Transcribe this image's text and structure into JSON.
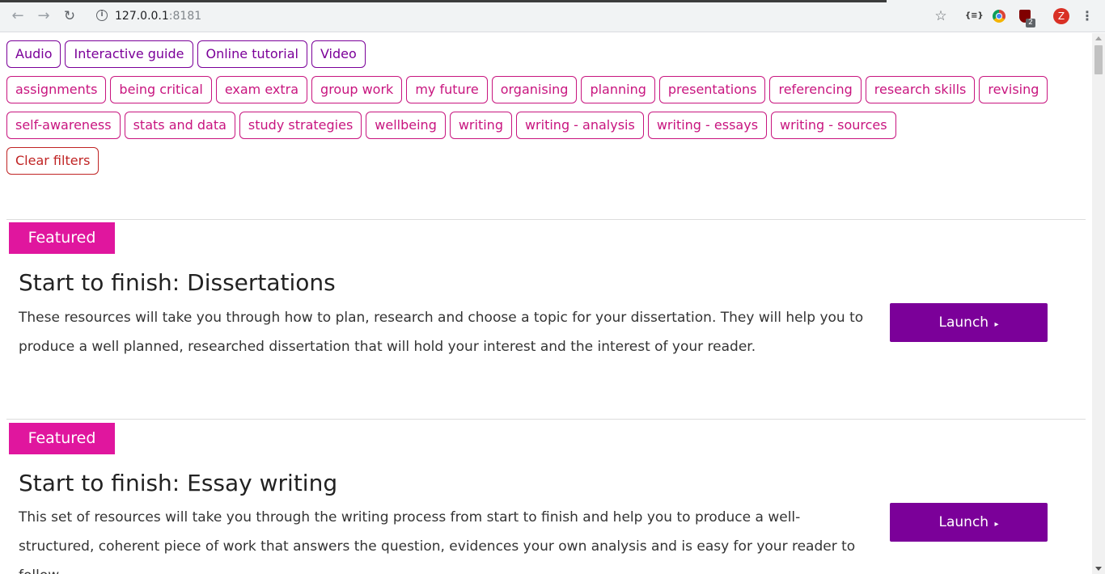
{
  "browser": {
    "url_host": "127.0.0.1",
    "url_port": ":8181",
    "back_icon": "arrow-left-icon",
    "forward_icon": "arrow-right-icon",
    "reload_icon": "reload-icon",
    "extensions": {
      "json_viewer": "{≡}",
      "ublock_badge": "2",
      "profile_initial": "Z"
    }
  },
  "filters": {
    "types": [
      "Audio",
      "Interactive guide",
      "Online tutorial",
      "Video"
    ],
    "topics_row1": [
      "assignments",
      "being critical",
      "exam extra",
      "group work",
      "my future",
      "organising",
      "planning",
      "presentations",
      "referencing",
      "research skills",
      "revising"
    ],
    "topics_row2": [
      "self-awareness",
      "stats and data",
      "study strategies",
      "wellbeing",
      "writing",
      "writing - analysis",
      "writing - essays",
      "writing - sources"
    ],
    "clear_label": "Clear filters"
  },
  "cards": [
    {
      "badge": "Featured",
      "title": "Start to finish: Dissertations",
      "description": "These resources will take you through how to plan, research and choose a topic for your dissertation. They will help you to produce a well planned, researched dissertation that will hold your interest and the interest of your reader.",
      "launch_label": "Launch",
      "launch_caret": "▸"
    },
    {
      "badge": "Featured",
      "title": "Start to finish: Essay writing",
      "description": "This set of resources will take you through the writing process from start to finish and help you to produce a well-structured, coherent piece of work that answers the question, evidences your own analysis and is easy for your reader to follow.",
      "launch_label": "Launch",
      "launch_caret": "▸"
    }
  ],
  "colors": {
    "type_filter": "#7b0099",
    "topic_filter": "#c8157f",
    "clear_filter": "#c02424",
    "featured_badge": "#e0169e",
    "launch_button": "#7b0099"
  }
}
